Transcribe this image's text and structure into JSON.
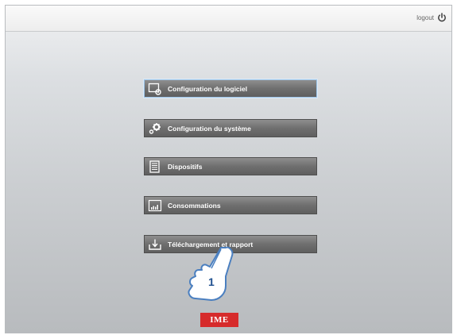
{
  "topbar": {
    "logout_label": "logout",
    "logout_icon": "power-icon"
  },
  "menu": {
    "items": [
      {
        "label": "Configuration du logiciel",
        "icon": "monitor-gear-icon"
      },
      {
        "label": "Configuration du système",
        "icon": "gears-icon"
      },
      {
        "label": "Dispositifs",
        "icon": "document-list-icon"
      },
      {
        "label": "Consommations",
        "icon": "bar-chart-icon"
      },
      {
        "label": "Téléchargement et rapport",
        "icon": "download-icon"
      }
    ]
  },
  "annotation": {
    "step_number": "1",
    "icon": "pointing-hand-icon"
  },
  "brand": {
    "logo_text": "IME",
    "color": "#d62b2b"
  },
  "colors": {
    "button_fill": "#6f6f6f",
    "active_border": "#9ec5e8"
  }
}
